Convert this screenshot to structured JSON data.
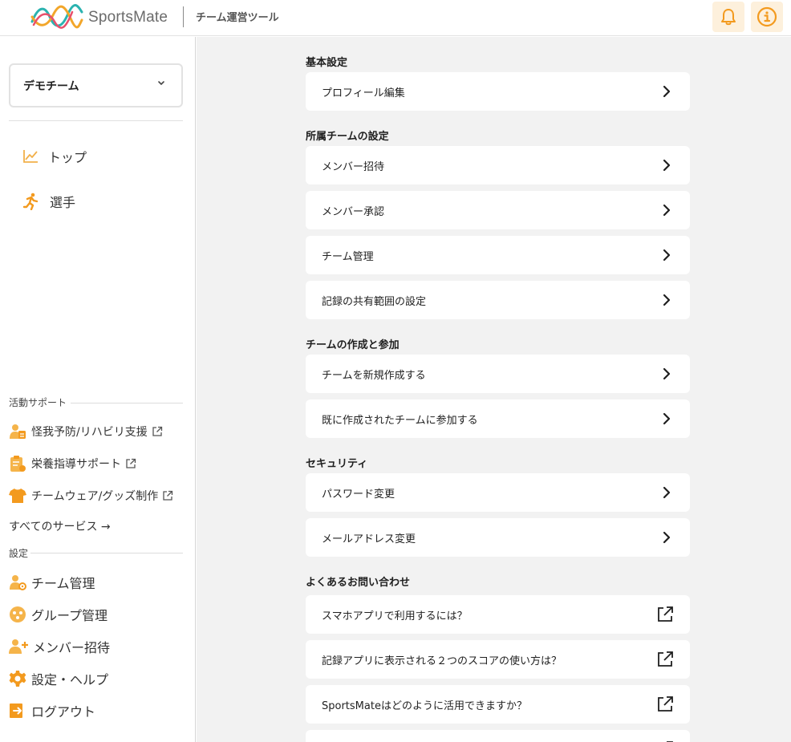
{
  "header": {
    "logo_text": "SportsMate",
    "subtitle": "チーム運営ツール",
    "notification_icon": "bell-icon",
    "info_icon": "info-icon",
    "accent_color": "#f39a1e",
    "accent_bg": "#fdf0dc"
  },
  "sidebar": {
    "team_select": {
      "value": "デモチーム"
    },
    "nav": [
      {
        "label": "トップ",
        "icon": "chart-line-icon"
      },
      {
        "label": "選手",
        "icon": "runner-icon"
      }
    ],
    "support": {
      "title": "活動サポート",
      "items": [
        {
          "label": "怪我予防/リハビリ支援",
          "icon": "doctor-icon"
        },
        {
          "label": "栄養指導サポート",
          "icon": "clipboard-icon"
        },
        {
          "label": "チームウェア/グッズ制作",
          "icon": "tshirt-icon"
        }
      ],
      "all_services": "すべてのサービス →"
    },
    "settings": {
      "title": "設定",
      "items": [
        {
          "label": "チーム管理",
          "icon": "user-gear-icon"
        },
        {
          "label": "グループ管理",
          "icon": "group-icon"
        },
        {
          "label": "メンバー招待",
          "icon": "user-plus-icon"
        },
        {
          "label": "設定・ヘルプ",
          "icon": "gear-icon"
        },
        {
          "label": "ログアウト",
          "icon": "logout-icon"
        }
      ]
    }
  },
  "main": {
    "groups": [
      {
        "title": "基本設定",
        "items": [
          "プロフィール編集"
        ]
      },
      {
        "title": "所属チームの設定",
        "items": [
          "メンバー招待",
          "メンバー承認",
          "チーム管理",
          "記録の共有範囲の設定"
        ]
      },
      {
        "title": "チームの作成と参加",
        "items": [
          "チームを新規作成する",
          "既に作成されたチームに参加する"
        ]
      },
      {
        "title": "セキュリティ",
        "items": [
          "パスワード変更",
          "メールアドレス変更"
        ]
      },
      {
        "title": "よくあるお問い合わせ",
        "items": [
          "スマホアプリで利用するには？",
          "記録アプリに表示される２つのスコアの使い方は？",
          "SportsMateはどのように活用できますか？"
        ]
      }
    ]
  }
}
